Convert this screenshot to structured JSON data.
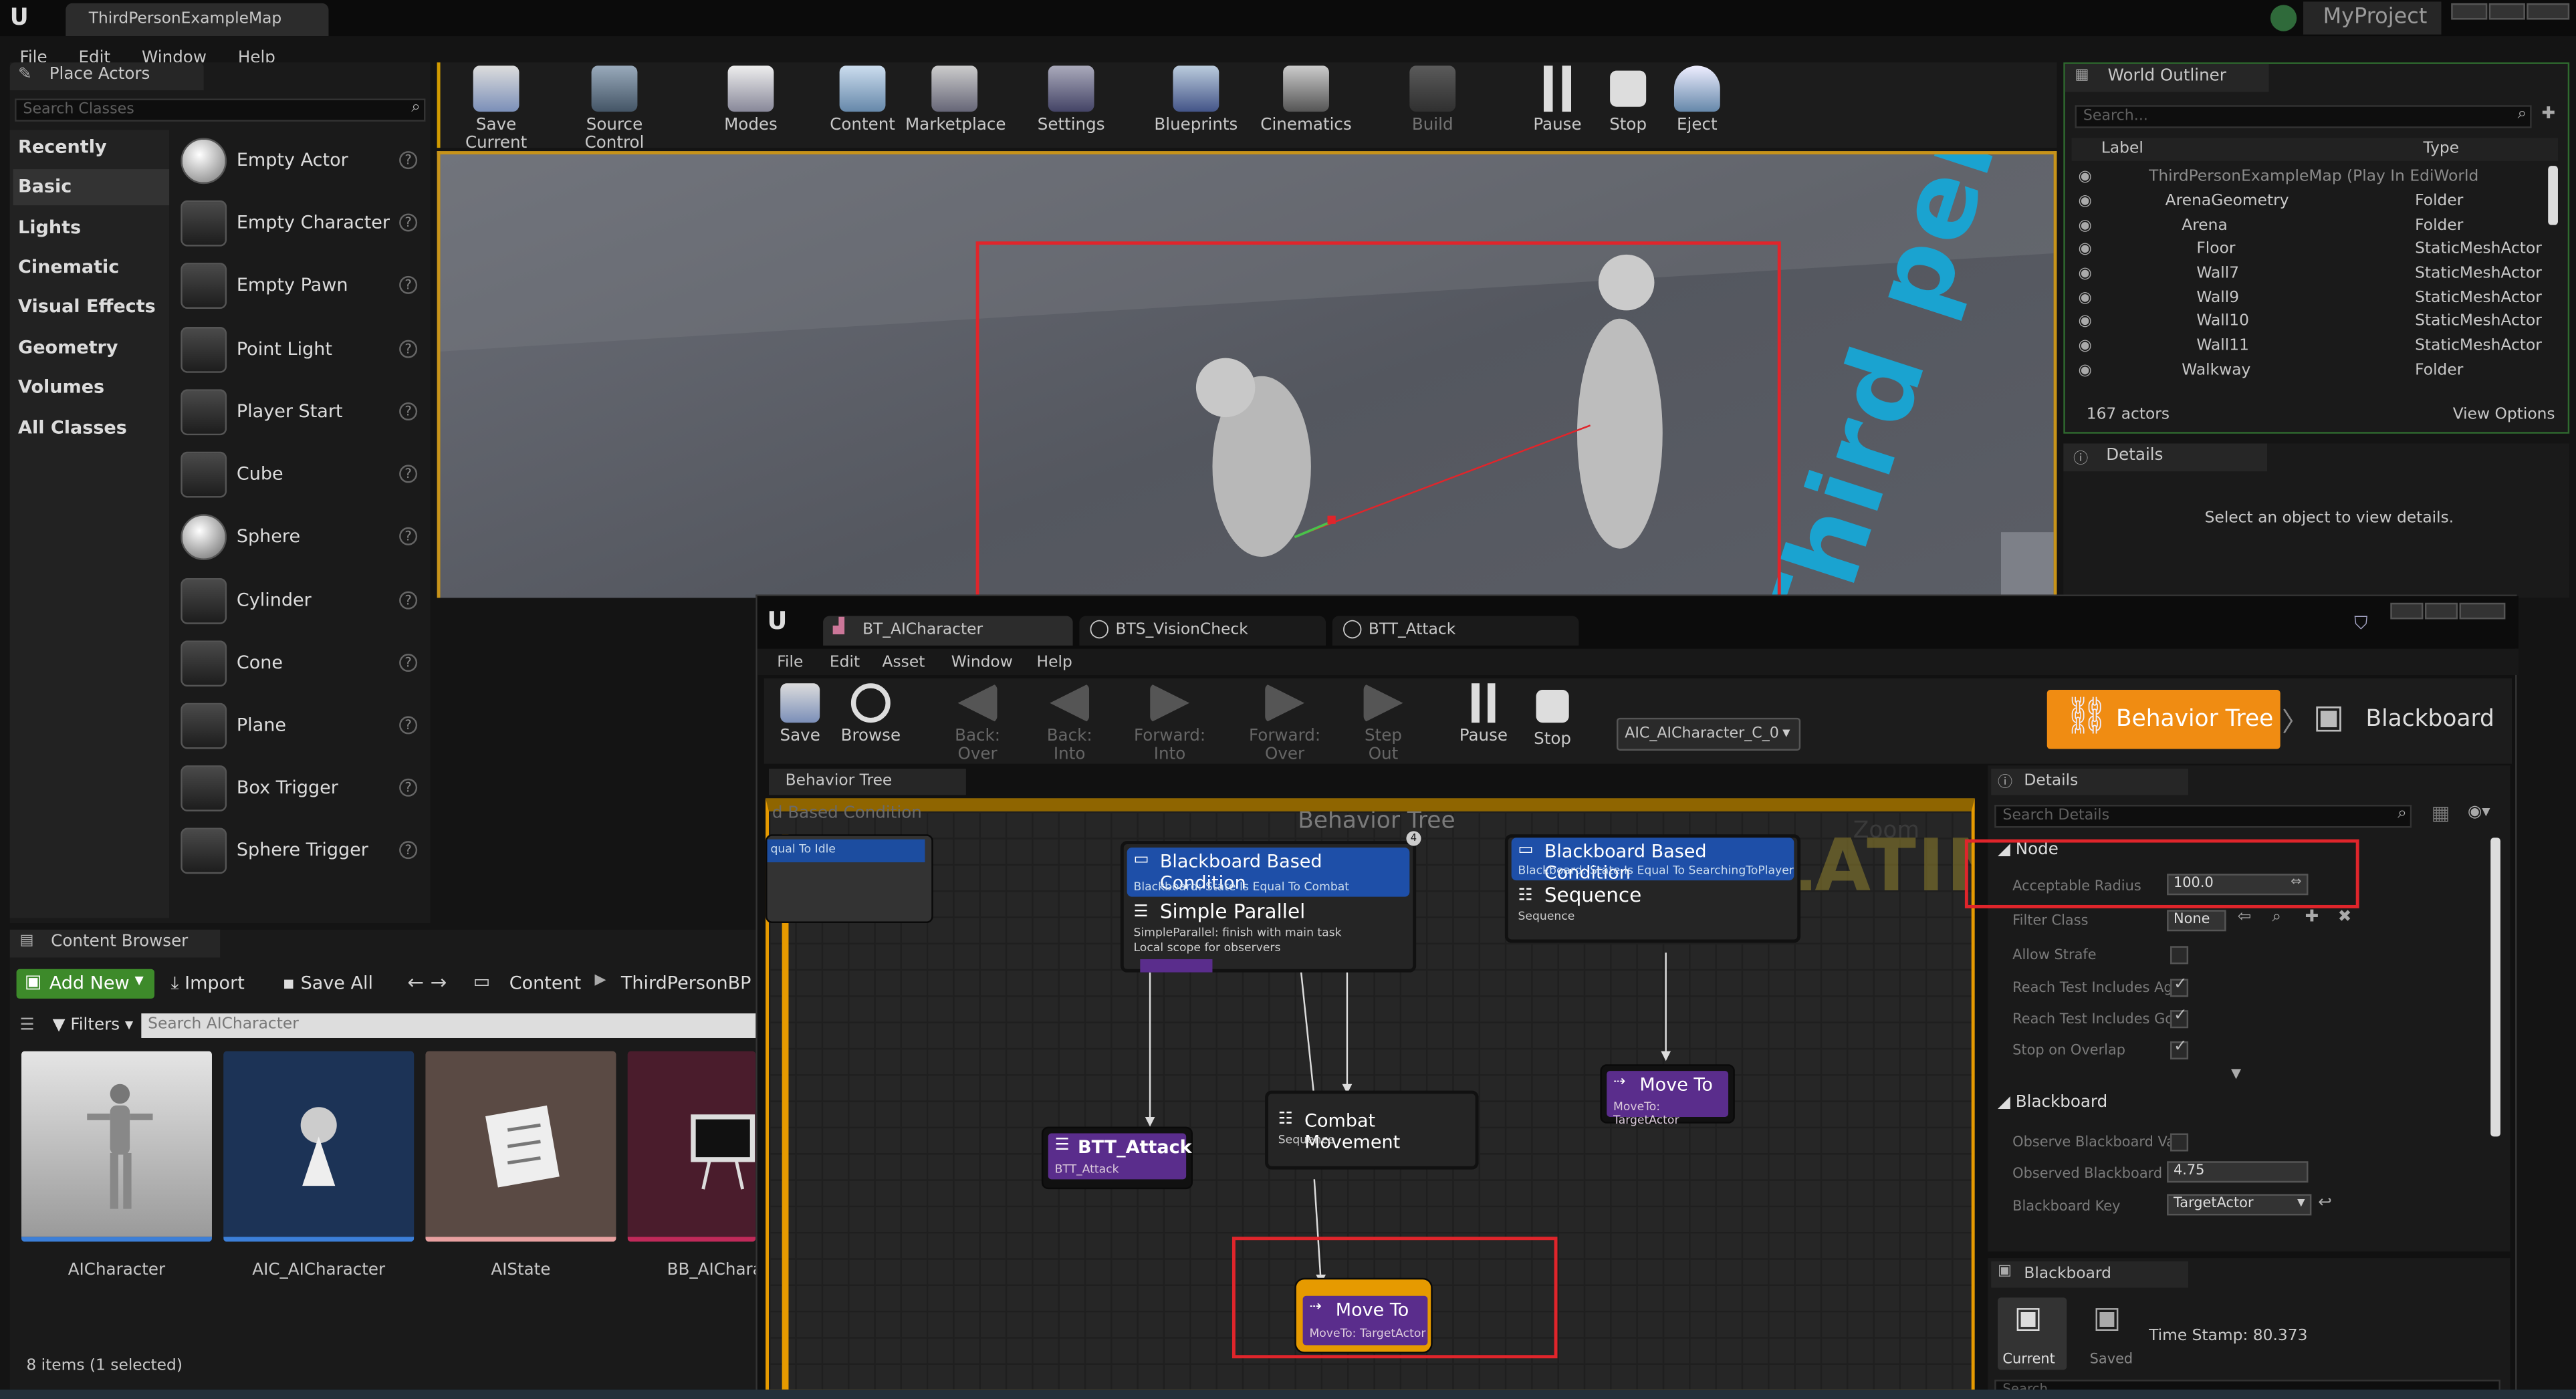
{
  "title_tab": "ThirdPersonExampleMap",
  "project_name": "MyProject",
  "main_menu": [
    "File",
    "Edit",
    "Window",
    "Help"
  ],
  "place_actors": {
    "tab_label": "Place Actors",
    "search_placeholder": "Search Classes",
    "categories": [
      "Recently Placed",
      "Basic",
      "Lights",
      "Cinematic",
      "Visual Effects",
      "Geometry",
      "Volumes",
      "All Classes"
    ],
    "items": [
      "Empty Actor",
      "Empty Character",
      "Empty Pawn",
      "Point Light",
      "Player Start",
      "Cube",
      "Sphere",
      "Cylinder",
      "Cone",
      "Plane",
      "Box Trigger",
      "Sphere Trigger"
    ]
  },
  "main_toolbar": [
    "Save Current",
    "Source Control",
    "Modes",
    "Content",
    "Marketplace",
    "Settings",
    "Blueprints",
    "Cinematics",
    "Build",
    "Pause",
    "Stop",
    "Eject"
  ],
  "viewport": {
    "signage_text": "Third person"
  },
  "world_outliner": {
    "tab_label": "World Outliner",
    "search_placeholder": "Search...",
    "col_label": "Label",
    "col_type": "Type",
    "rows": [
      {
        "label": "ThirdPersonExampleMap (Play In EdiWorld",
        "type": ""
      },
      {
        "label": "ArenaGeometry",
        "type": "Folder"
      },
      {
        "label": "Arena",
        "type": "Folder"
      },
      {
        "label": "Floor",
        "type": "StaticMeshActor"
      },
      {
        "label": "Wall7",
        "type": "StaticMeshActor"
      },
      {
        "label": "Wall9",
        "type": "StaticMeshActor"
      },
      {
        "label": "Wall10",
        "type": "StaticMeshActor"
      },
      {
        "label": "Wall11",
        "type": "StaticMeshActor"
      },
      {
        "label": "Walkway",
        "type": "Folder"
      }
    ],
    "actor_count": "167 actors",
    "view_options": "View Options"
  },
  "details_main": {
    "tab_label": "Details",
    "empty_message": "Select an object to view details."
  },
  "content_browser": {
    "tab_label": "Content Browser",
    "add_new": "Add New",
    "import": "Import",
    "save_all": "Save All",
    "path": [
      "Content",
      "ThirdPersonBP"
    ],
    "filters": "Filters",
    "search_placeholder": "Search AICharacter",
    "assets": [
      "AICharacter",
      "AIC_AICharacter",
      "AIState",
      "BB_AICharac"
    ],
    "status": "8 items (1 selected)"
  },
  "bt_editor": {
    "tabs": [
      "BT_AICharacter",
      "BTS_VisionCheck",
      "BTT_Attack"
    ],
    "menu": [
      "File",
      "Edit",
      "Asset",
      "Window",
      "Help"
    ],
    "toolbar": [
      "Save",
      "Browse",
      "Back: Over",
      "Back: Into",
      "Forward: Into",
      "Forward: Over",
      "Step Out",
      "Pause",
      "Stop"
    ],
    "debug_dropdown": "AIC_AICharacter_C_0",
    "mode_active": "Behavior Tree",
    "mode_other": "Blackboard",
    "graph_tab": "Behavior Tree",
    "graph_title": "Behavior Tree",
    "graph_overlay": "SIMULATING",
    "graph_zoom": "Zoom",
    "nodes": {
      "partial_top": "d Based Condition",
      "partial_sub": "qual To Idle",
      "bb_condition_1": {
        "title": "Blackboard Based Condition",
        "sub": "Blackboard: State Is Equal To Combat"
      },
      "simple_parallel": {
        "title": "Simple Parallel",
        "sub1": "SimpleParallel: finish with main task",
        "sub2": "Local scope for observers"
      },
      "bb_condition_2": {
        "title": "Blackboard Based Condition",
        "sub": "Blackboard: State Is Equal To SearchingToPlayer"
      },
      "sequence": {
        "title": "Sequence",
        "sub": "Sequence"
      },
      "btt_attack": {
        "title": "BTT_Attack",
        "sub": "BTT_Attack"
      },
      "combat_movement": {
        "title": "Combat Movement",
        "sub": "Sequence"
      },
      "move_to_right": {
        "title": "Move To",
        "sub": "MoveTo: TargetActor"
      },
      "move_to_bottom": {
        "title": "Move To",
        "sub": "MoveTo: TargetActor"
      }
    },
    "details": {
      "tab_label": "Details",
      "search_placeholder": "Search Details",
      "node_section": "Node",
      "acceptable_radius_label": "Acceptable Radius",
      "acceptable_radius_value": "100.0",
      "filter_class_label": "Filter Class",
      "filter_class_value": "None",
      "allow_strafe_label": "Allow Strafe",
      "reach_agent_label": "Reach Test Includes Age",
      "reach_goal_label": "Reach Test Includes Goa",
      "stop_overlap_label": "Stop on Overlap",
      "blackboard_section": "Blackboard",
      "observe_label": "Observe Blackboard Val",
      "observed_tol_label": "Observed Blackboard Va",
      "observed_tol_value": "4.75",
      "bb_key_label": "Blackboard Key",
      "bb_key_value": "TargetActor"
    },
    "blackboard_panel": {
      "tab_label": "Blackboard",
      "current": "Current",
      "saved": "Saved",
      "timestamp": "Time Stamp: 80.373",
      "search_placeholder": "Search"
    }
  },
  "colors": {
    "accent_orange": "#f08c12",
    "highlight_red": "#e0252b",
    "composite_blue": "#1e3c78",
    "task_purple": "#5a2d8c",
    "decorator_blue": "#1c4da0"
  }
}
